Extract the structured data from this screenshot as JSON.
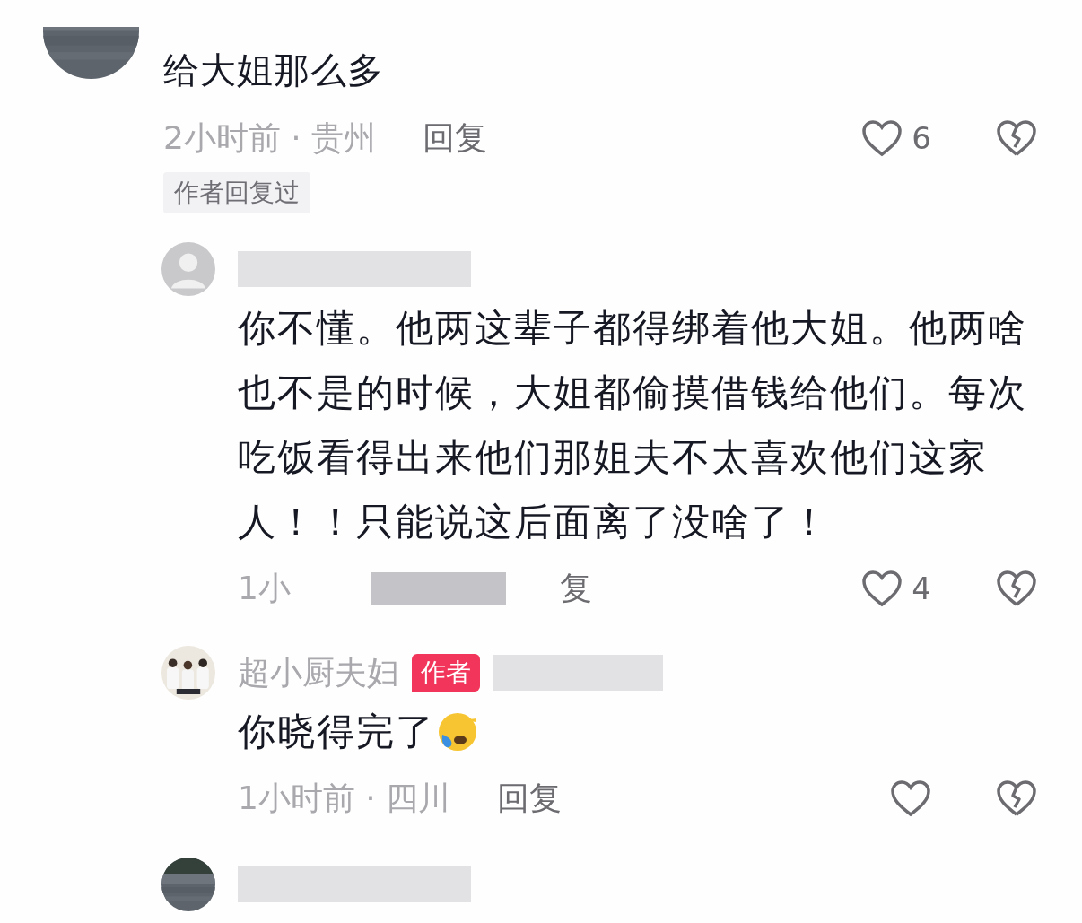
{
  "comments": [
    {
      "kind": "comment",
      "text": "给大姐那么多",
      "time": "2小时前 · 贵州",
      "reply": "回复",
      "likes": "6",
      "tag": "作者回复过"
    },
    {
      "kind": "reply",
      "avatar": {
        "kind": "default"
      },
      "name_redacted": true,
      "text": "你不懂。他两这辈子都得绑着他大姐。他两啥也不是的时候，大姐都偷摸借钱给他们。每次吃饭看得出来他们那姐夫不太喜欢他们这家人！！只能说这后面离了没啥了！",
      "time": "1小",
      "time_redacted": true,
      "reply": "复",
      "likes": "4"
    },
    {
      "kind": "reply",
      "avatar": {
        "kind": "family"
      },
      "name": "超小厨夫妇",
      "badge": "作者",
      "name_redacted": true,
      "text": "你晓得完了",
      "emoji": {
        "kind": "crying"
      },
      "time": "1小时前 · 四川",
      "reply": "回复"
    },
    {
      "kind": "reply",
      "name_redacted": true
    }
  ]
}
